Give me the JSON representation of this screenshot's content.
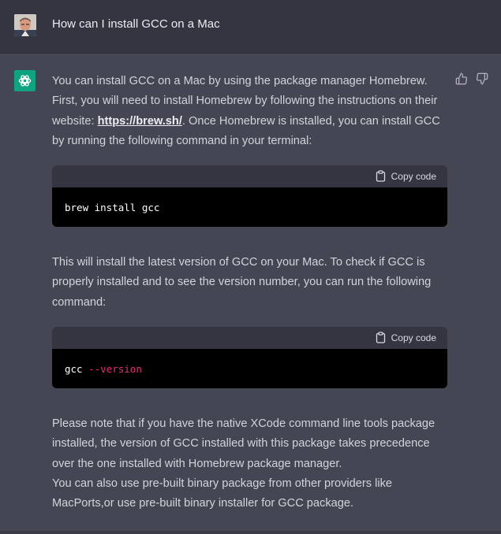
{
  "user": {
    "question": "How can I install GCC on a Mac"
  },
  "assistant": {
    "para1_before_link": "You can install GCC on a Mac by using the package manager Homebrew. First, you will need to install Homebrew by following the instructions on their website: ",
    "link_text": "https://brew.sh/",
    "para1_after_link": ". Once Homebrew is installed, you can install GCC by running the following command in your terminal:",
    "code1": {
      "copy_label": "Copy code",
      "text": "brew install gcc"
    },
    "para2": "This will install the latest version of GCC on your Mac. To check if GCC is properly installed and to see the version number, you can run the following command:",
    "code2": {
      "copy_label": "Copy code",
      "cmd": "gcc ",
      "flag": "--version"
    },
    "para3_line1": "Please note that if you have the native XCode command line tools package installed, the version of GCC installed with this package takes precedence over the one installed with Homebrew package manager.",
    "para3_line2": "You can also use pre-built binary package from other providers like MacPorts,or use pre-built binary installer for GCC package."
  },
  "colors": {
    "user_bg": "#343541",
    "assistant_bg": "#444654",
    "accent": "#10a37f",
    "flag": "#df3079"
  }
}
